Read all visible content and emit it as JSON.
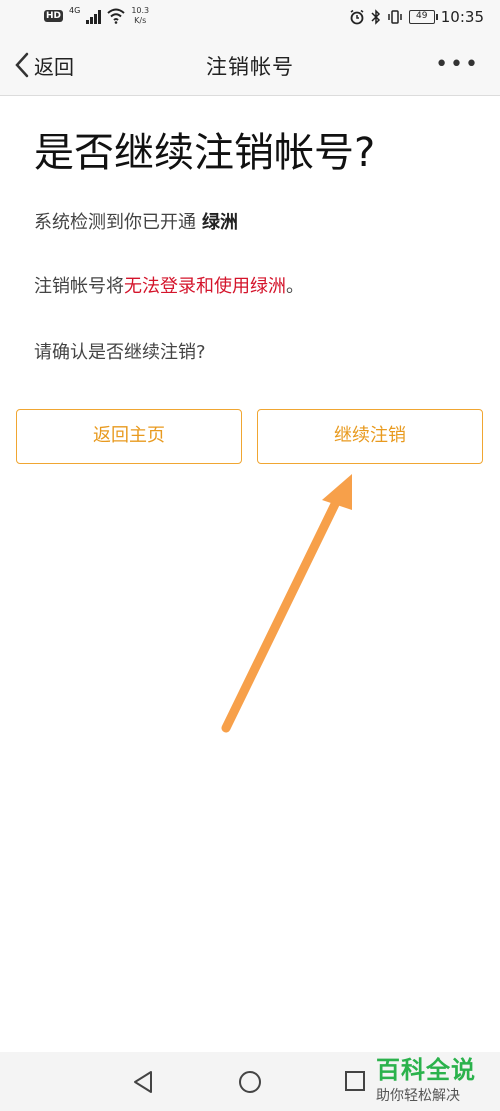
{
  "status_bar": {
    "hd": "HD",
    "network": "4G",
    "speed_value": "10.3",
    "speed_unit": "K/s",
    "battery": "49",
    "time": "10:35"
  },
  "nav": {
    "back_label": "返回",
    "title": "注销帐号",
    "more": "•••"
  },
  "page": {
    "heading": "是否继续注销帐号?",
    "detect_text": "系统检测到你已开通",
    "detect_app": "绿洲",
    "warn_prefix": "注销帐号将",
    "warn_red": "无法登录和使用绿洲",
    "warn_suffix": "。",
    "confirm_text": "请确认是否继续注销?"
  },
  "buttons": {
    "home": "返回主页",
    "continue": "继续注销"
  },
  "colors": {
    "accent": "#f0a632",
    "warning": "#d4142b",
    "arrow": "#f7a04a"
  },
  "watermark": {
    "main": "百科全说",
    "sub": "助你轻松解决"
  }
}
